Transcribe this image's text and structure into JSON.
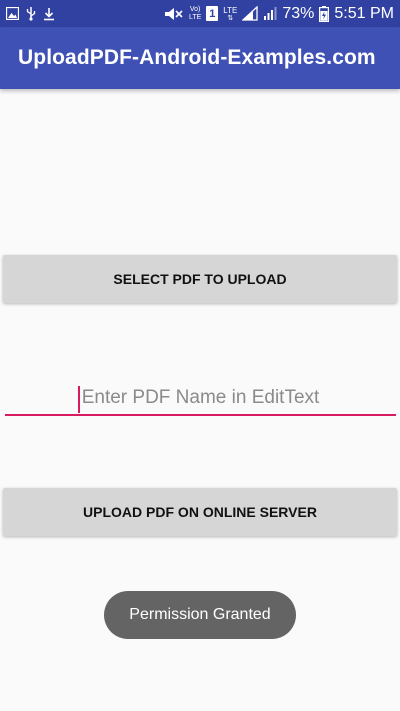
{
  "status_bar": {
    "lte_label": "LTE",
    "sim_label": "1",
    "lte_label_2": "LTE",
    "battery": "73%",
    "time": "5:51 PM",
    "background_color": "#3141a2"
  },
  "app_bar": {
    "title": "UploadPDF-Android-Examples.com",
    "background_color": "#3f51b5"
  },
  "main": {
    "select_button_label": "SELECT PDF TO UPLOAD",
    "pdf_name_input": {
      "value": "",
      "placeholder": "Enter PDF Name in EditText",
      "accent_color": "#d81b60"
    },
    "upload_button_label": "UPLOAD PDF ON ONLINE SERVER"
  },
  "toast": {
    "message": "Permission Granted"
  },
  "icons": [
    "gallery-icon",
    "usb-icon",
    "download-icon",
    "mute-icon",
    "volte-icon",
    "sim-icon",
    "signal-icon",
    "battery-icon"
  ]
}
